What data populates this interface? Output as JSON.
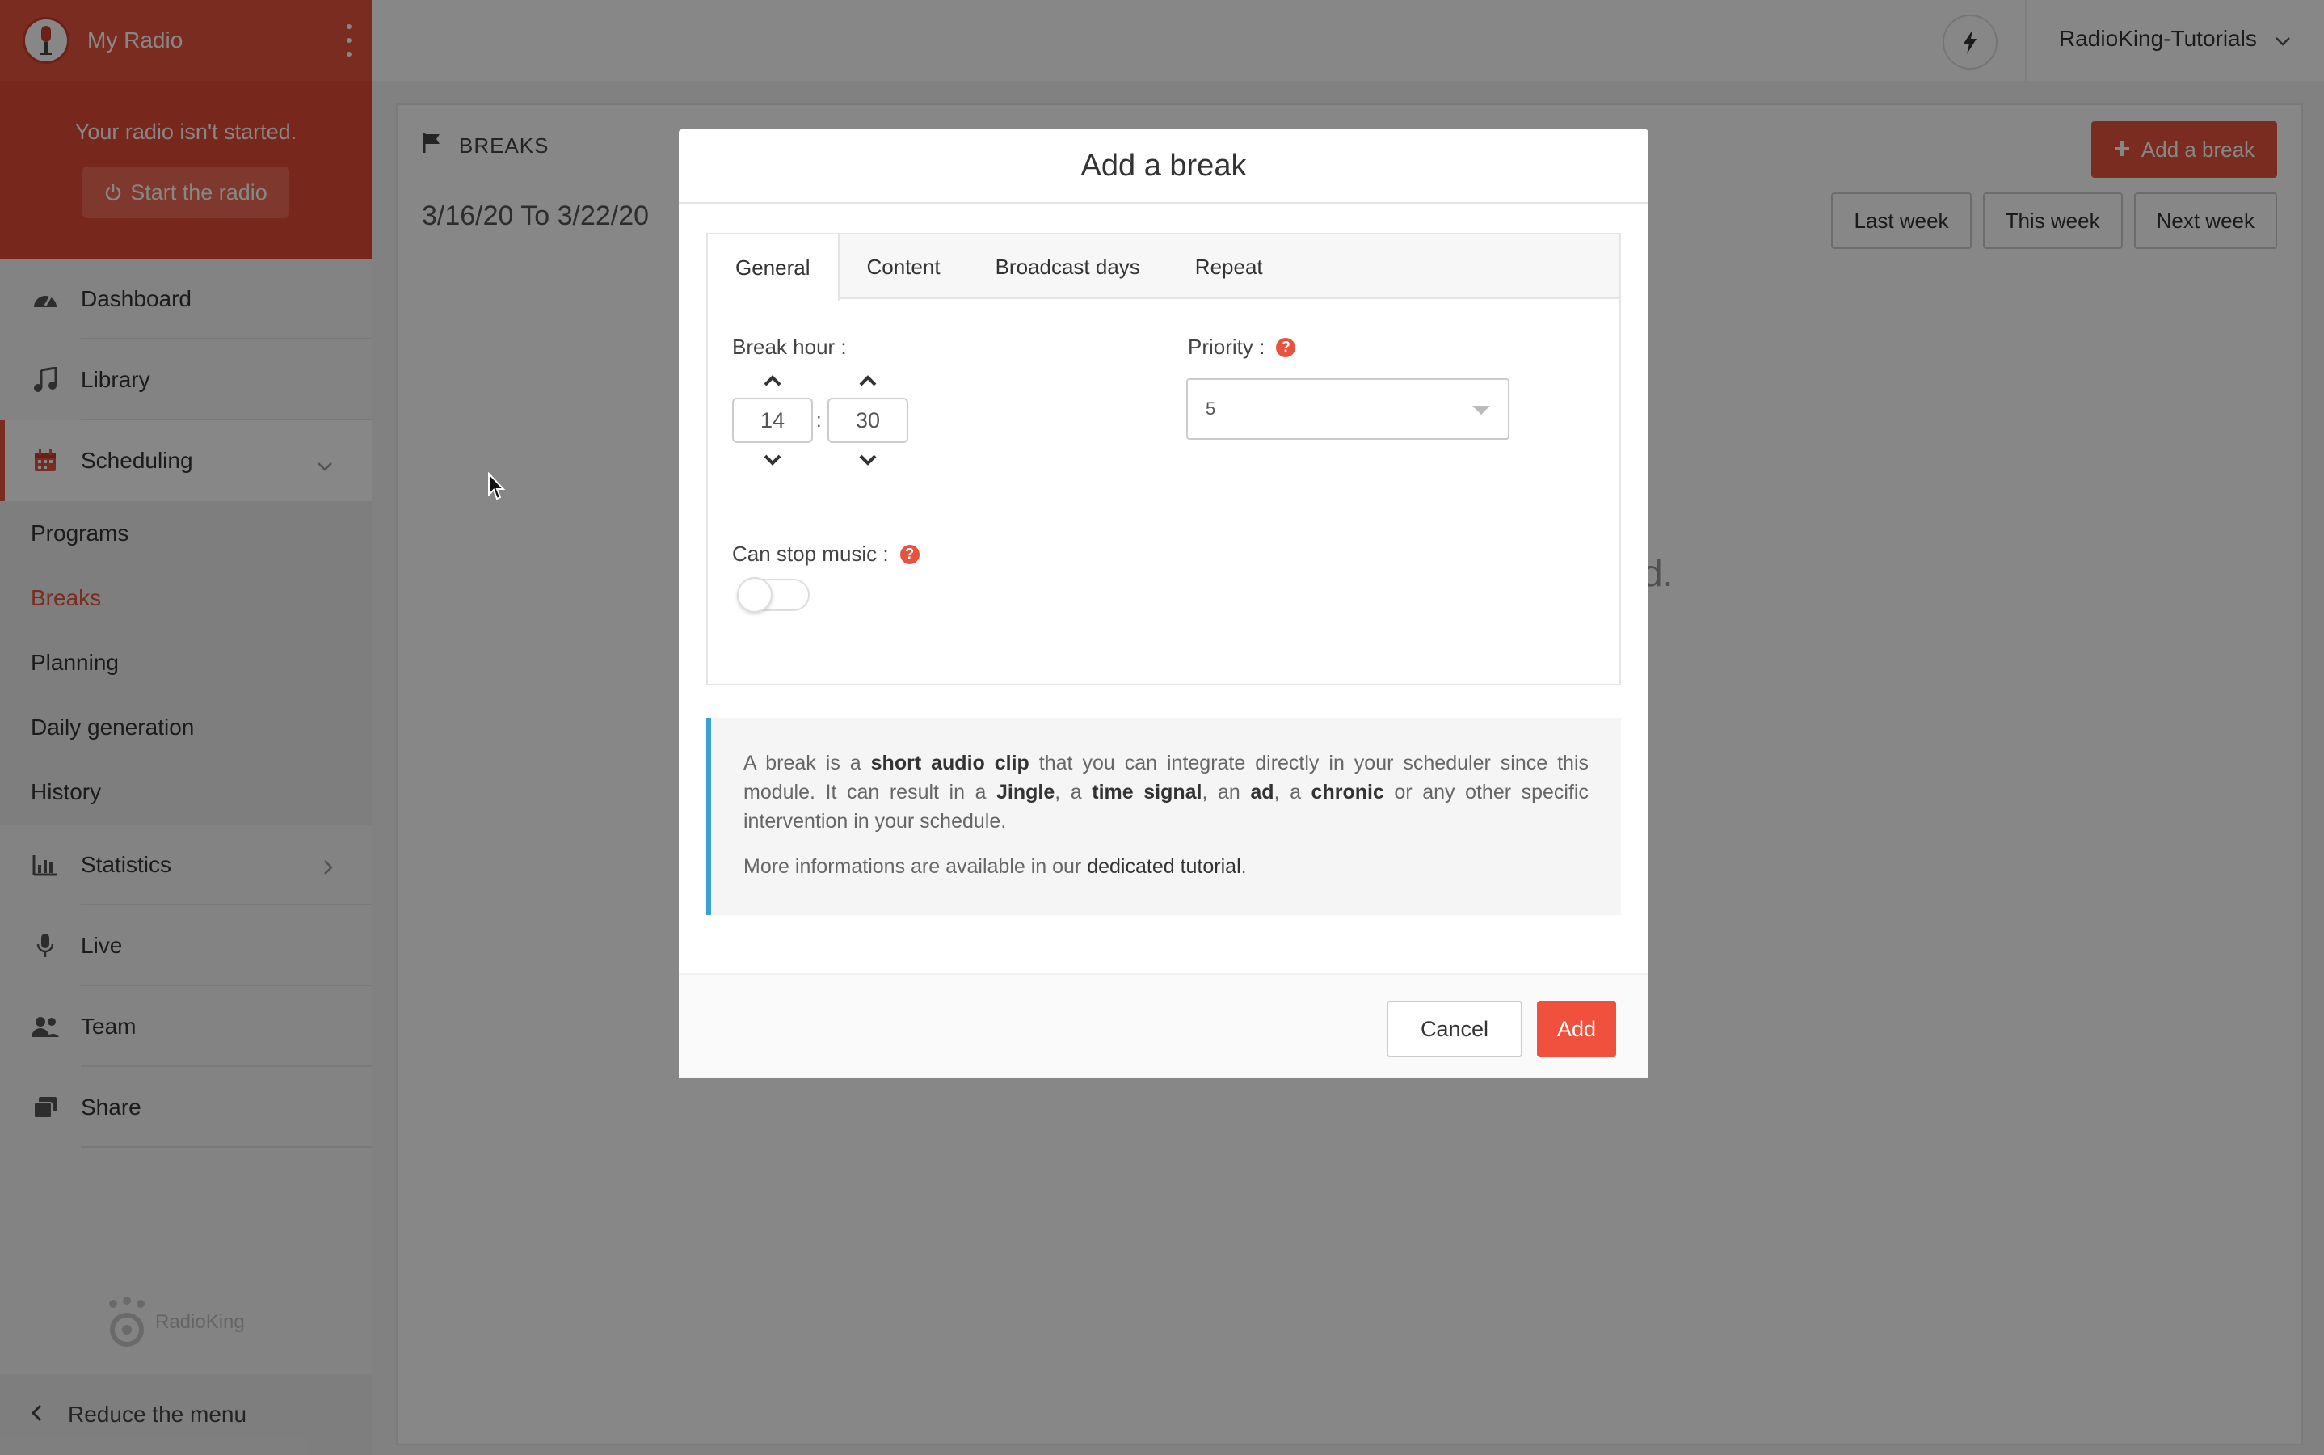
{
  "sidebar": {
    "radio_name": "My Radio",
    "status_text": "Your radio isn't started.",
    "start_button": "Start the radio",
    "nav": [
      {
        "label": "Dashboard",
        "icon": "dashboard-icon"
      },
      {
        "label": "Library",
        "icon": "music-note-icon"
      },
      {
        "label": "Scheduling",
        "icon": "calendar-icon"
      },
      {
        "label": "Statistics",
        "icon": "bar-chart-icon"
      },
      {
        "label": "Live",
        "icon": "microphone-icon"
      },
      {
        "label": "Team",
        "icon": "users-icon"
      },
      {
        "label": "Share",
        "icon": "share-icon"
      }
    ],
    "subnav": [
      "Programs",
      "Breaks",
      "Planning",
      "Daily generation",
      "History"
    ],
    "logo_text": "RadioKing",
    "reduce_menu": "Reduce the menu"
  },
  "topbar": {
    "account_name": "RadioKing-Tutorials"
  },
  "page": {
    "section_title": "BREAKS",
    "add_break_button": "Add a break",
    "date_range": "3/16/20 To 3/22/20",
    "week_buttons": [
      "Last week",
      "This week",
      "Next week"
    ],
    "empty_text_fragment": "d."
  },
  "modal": {
    "title": "Add a break",
    "tabs": [
      "General",
      "Content",
      "Broadcast days",
      "Repeat"
    ],
    "break_hour_label": "Break hour :",
    "hour": "14",
    "minute": "30",
    "separator": ":",
    "priority_label": "Priority :",
    "priority_value": "5",
    "can_stop_music_label": "Can stop music :",
    "can_stop_music": false,
    "help_glyph": "?",
    "info": {
      "p1_a": "A break is a ",
      "p1_b": "short audio clip",
      "p1_c": " that you can integrate directly in your scheduler since this module. It can result in a ",
      "p1_d": "Jingle",
      "p1_e": ", a ",
      "p1_f": "time signal",
      "p1_g": ", an ",
      "p1_h": "ad",
      "p1_i": ", a ",
      "p1_j": "chronic",
      "p1_k": " or any other specific intervention in your schedule.",
      "p2_a": "More informations are available in our ",
      "p2_link": "dedicated tutorial",
      "p2_b": "."
    },
    "cancel_button": "Cancel",
    "add_button": "Add"
  },
  "colors": {
    "brand_red": "#e8533f",
    "info_border": "#3ba1d1"
  }
}
